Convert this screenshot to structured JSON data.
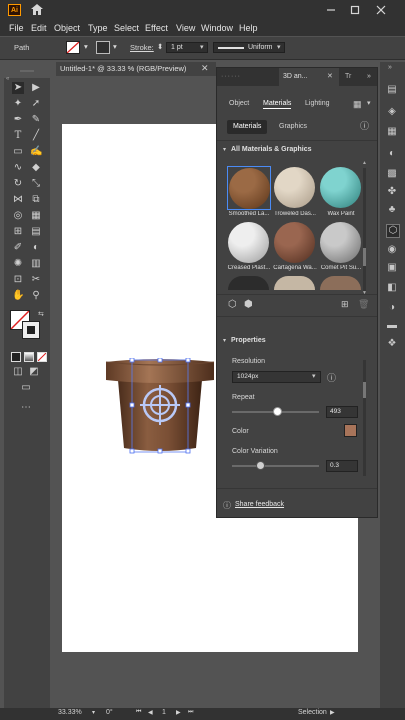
{
  "app": {
    "logo_text": "Ai"
  },
  "menu": [
    "File",
    "Edit",
    "Object",
    "Type",
    "Select",
    "Effect",
    "View",
    "Window",
    "Help"
  ],
  "control_bar": {
    "selection_label": "Path",
    "stroke_label": "Stroke:",
    "stroke_weight": "1 pt",
    "profile": "Uniform"
  },
  "document": {
    "tab_title": "Untitled-1* @ 33.33 % (RGB/Preview)"
  },
  "panel": {
    "tab_label": "3D an...",
    "tab_overflow": "Tr",
    "tabs": [
      "Object",
      "Materials",
      "Lighting"
    ],
    "active_tab": "Materials",
    "subtabs": [
      "Materials",
      "Graphics"
    ],
    "section_title": "All Materials & Graphics",
    "materials": [
      {
        "label": "Smoothed La...",
        "colors": [
          "#9b6a45",
          "#5b3418"
        ]
      },
      {
        "label": "Troweled Das...",
        "colors": [
          "#e2d7c6",
          "#a89986"
        ]
      },
      {
        "label": "Wax Paint",
        "colors": [
          "#7fd3cf",
          "#2d7e7a"
        ]
      },
      {
        "label": "Creased Plast...",
        "colors": [
          "#eeeeee",
          "#9a9a9a"
        ]
      },
      {
        "label": "Cartagena Wa...",
        "colors": [
          "#9a6650",
          "#4f2c1e"
        ]
      },
      {
        "label": "Comet Pit Su...",
        "colors": [
          "#c9c9c9",
          "#6a6a6a"
        ]
      }
    ],
    "properties_title": "Properties",
    "resolution_label": "Resolution",
    "resolution_value": "1024px",
    "repeat_label": "Repeat",
    "repeat_value": "493",
    "color_label": "Color",
    "color_swatch": "#a8745a",
    "color_variation_label": "Color Variation",
    "color_variation_value": "0.3",
    "feedback": "Share feedback"
  },
  "status_bar": {
    "zoom": "33.33%",
    "rotation": "0°",
    "artboard": "1",
    "tool": "Selection"
  },
  "colors": {
    "accent": "#4b8bf5",
    "panel": "#424242",
    "canvas": "#535353"
  }
}
